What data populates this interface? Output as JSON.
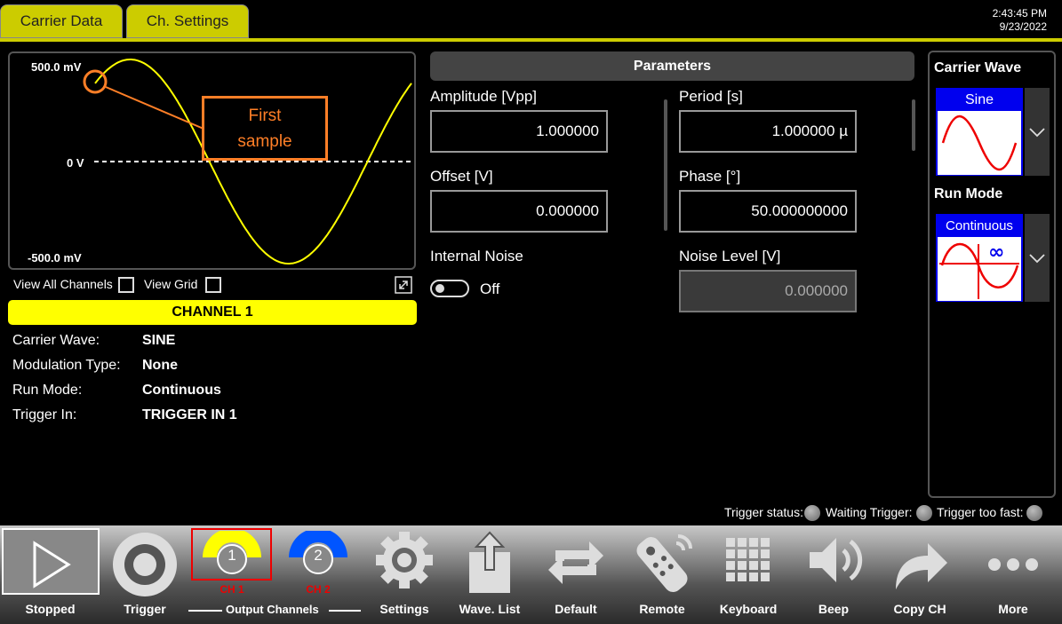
{
  "tabs": [
    {
      "label": "Carrier Data"
    },
    {
      "label": "Ch. Settings"
    }
  ],
  "clock": {
    "time": "2:43:45 PM",
    "date": "9/23/2022"
  },
  "plot": {
    "ymax_label": "500.0 mV",
    "zero_label": "0 V",
    "ymin_label": "-500.0 mV",
    "annotation": "First\nsample"
  },
  "view": {
    "all_channels": "View All Channels",
    "grid": "View Grid"
  },
  "channel": {
    "title": "CHANNEL 1",
    "rows": [
      {
        "key": "Carrier Wave:",
        "value": "SINE"
      },
      {
        "key": "Modulation Type:",
        "value": "None"
      },
      {
        "key": "Run Mode:",
        "value": "Continuous"
      },
      {
        "key": "Trigger In:",
        "value": "TRIGGER IN 1"
      }
    ]
  },
  "parameters": {
    "title": "Parameters",
    "amplitude": {
      "label": "Amplitude [Vpp]",
      "value": "1.000000"
    },
    "period": {
      "label": "Period [s]",
      "value": "1.000000 µ"
    },
    "offset": {
      "label": "Offset [V]",
      "value": "0.000000"
    },
    "phase": {
      "label": "Phase [°]",
      "value": "50.000000000"
    },
    "internal_noise": {
      "label": "Internal Noise",
      "state": "Off"
    },
    "noise_level": {
      "label": "Noise Level [V]",
      "value": "0.000000"
    }
  },
  "right_panel": {
    "carrier_wave": {
      "title": "Carrier Wave",
      "selected": "Sine"
    },
    "run_mode": {
      "title": "Run Mode",
      "selected": "Continuous"
    }
  },
  "trigger_status": {
    "label1": "Trigger status:",
    "label2": "Waiting Trigger:",
    "label3": "Trigger too fast:"
  },
  "toolbar": {
    "stopped": "Stopped",
    "trigger": "Trigger",
    "ch1_num": "1",
    "ch1": "CH 1",
    "ch2_num": "2",
    "ch2": "CH 2",
    "output_channels": "Output Channels",
    "settings": "Settings",
    "wave_list": "Wave. List",
    "default": "Default",
    "remote": "Remote",
    "keyboard": "Keyboard",
    "beep": "Beep",
    "copy_ch": "Copy CH",
    "more": "More"
  },
  "colors": {
    "accent": "#ffff00",
    "tab": "#cccc00",
    "annotation": "#ff7f27",
    "ch2": "#0055ff"
  }
}
